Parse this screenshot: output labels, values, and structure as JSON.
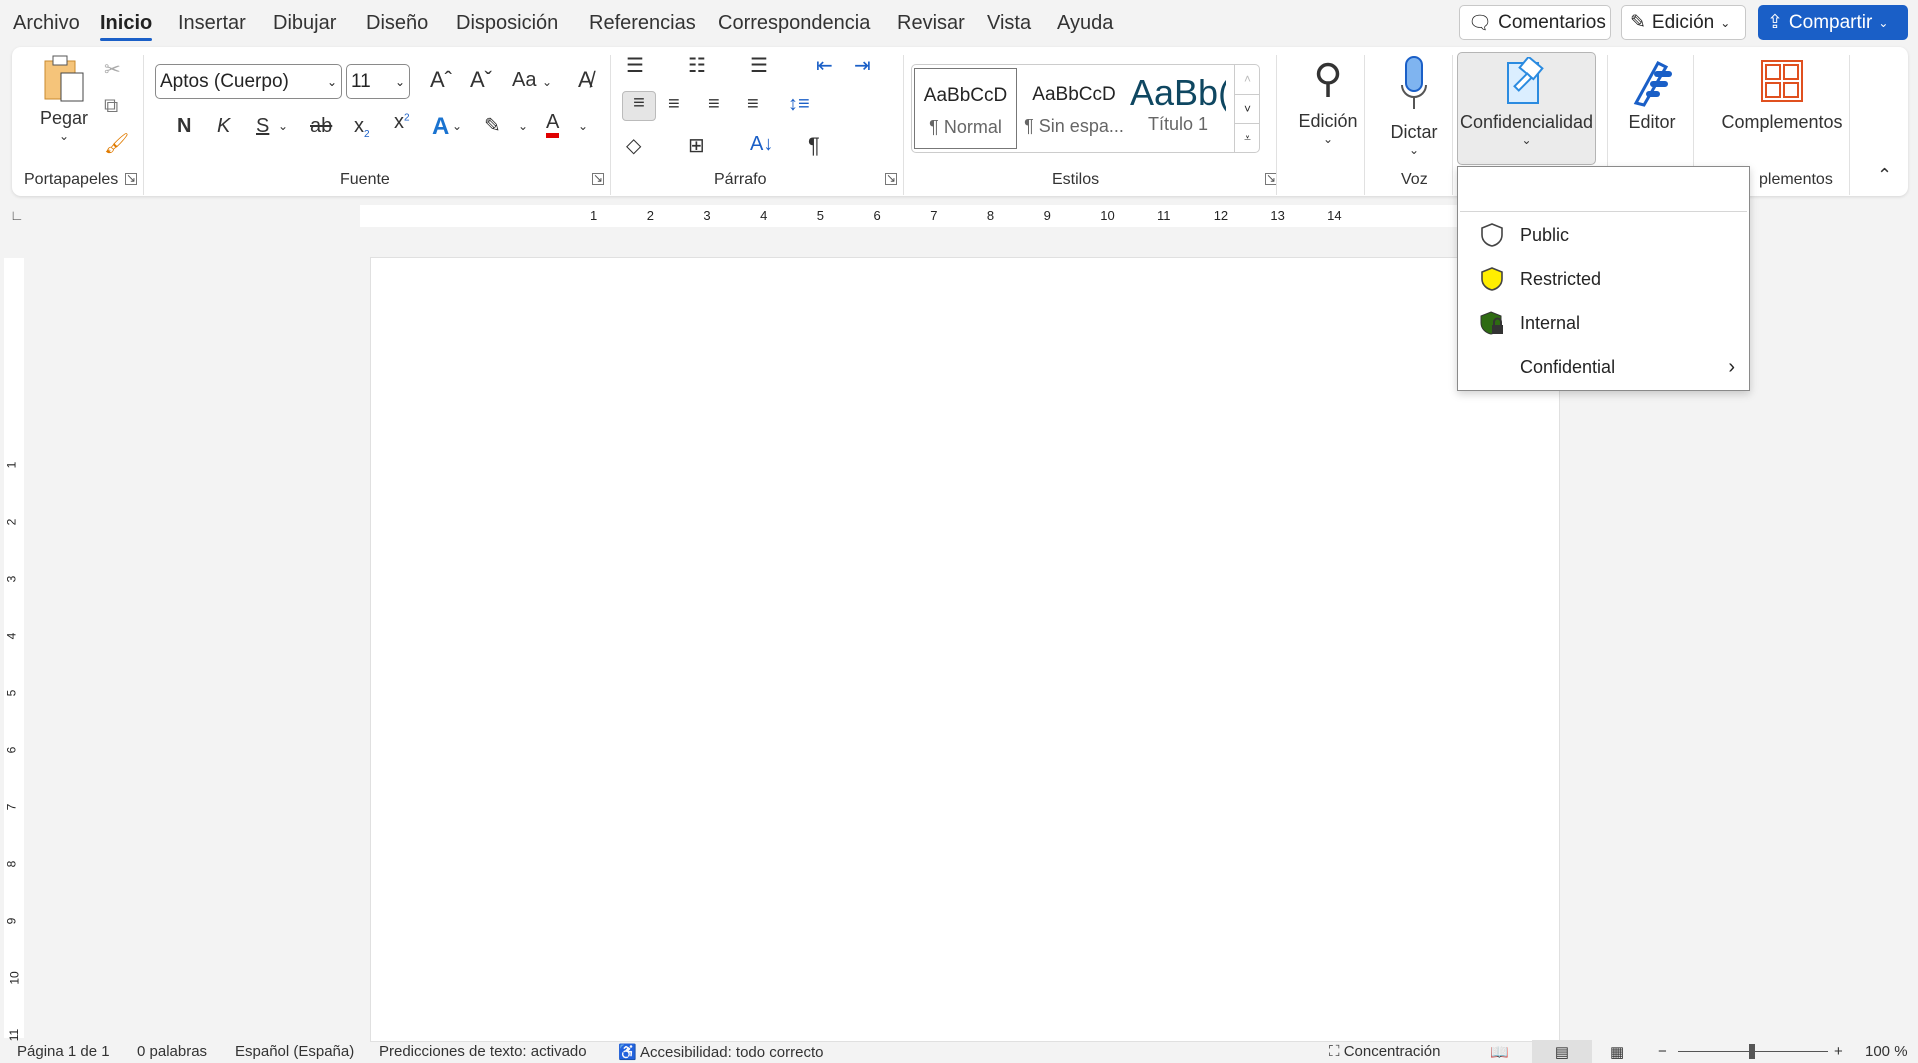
{
  "menu": {
    "tabs": [
      "Archivo",
      "Inicio",
      "Insertar",
      "Dibujar",
      "Diseño",
      "Disposición",
      "Referencias",
      "Correspondencia",
      "Revisar",
      "Vista",
      "Ayuda"
    ],
    "active": "Inicio"
  },
  "top_buttons": {
    "comments": "Comentarios",
    "editing": "Edición",
    "share": "Compartir"
  },
  "ribbon": {
    "clipboard": {
      "paste": "Pegar",
      "label": "Portapapeles"
    },
    "font": {
      "name": "Aptos (Cuerpo)",
      "size": "11",
      "case": "Aa",
      "bold": "N",
      "italic": "K",
      "underline": "S",
      "strike": "ab",
      "label": "Fuente"
    },
    "paragraph": {
      "label": "Párrafo"
    },
    "styles": {
      "items": [
        {
          "preview": "AaBbCcD",
          "name": "¶ Normal"
        },
        {
          "preview": "AaBbCcD",
          "name": "¶ Sin espa..."
        },
        {
          "preview": "AaBb(",
          "name": "Título 1"
        }
      ],
      "label": "Estilos"
    },
    "editing": {
      "label": "Edición"
    },
    "voice": {
      "dictate": "Dictar",
      "label": "Voz"
    },
    "sensitivity": {
      "label": "Confidencialidad"
    },
    "editor": {
      "label": "Editor"
    },
    "addins": {
      "button": "Complementos",
      "label": "plementos"
    }
  },
  "ruler": {
    "numbers": [
      "1",
      "2",
      "3",
      "4",
      "5",
      "6",
      "7",
      "8",
      "9",
      "10",
      "11",
      "12",
      "13",
      "14"
    ],
    "vnumbers": [
      "1",
      "2",
      "3",
      "4",
      "5",
      "6",
      "7",
      "8",
      "9",
      "10",
      "11"
    ]
  },
  "sensitivity_menu": {
    "items": [
      {
        "label": "Public",
        "icon": "shield-outline-icon",
        "color": "#ffffff"
      },
      {
        "label": "Restricted",
        "icon": "shield-yellow-icon",
        "color": "#ffee00"
      },
      {
        "label": "Internal",
        "icon": "shield-green-lock-icon",
        "color": "#2e6b12"
      },
      {
        "label": "Confidential",
        "icon": "",
        "submenu": true
      }
    ]
  },
  "status": {
    "page": "Página 1 de 1",
    "words": "0 palabras",
    "language": "Español (España)",
    "predictions": "Predicciones de texto: activado",
    "accessibility": "Accesibilidad: todo correcto",
    "focus": "Concentración",
    "zoom": "100 %"
  },
  "colors": {
    "accent": "#1a5fc7",
    "font_color": "#e00000"
  }
}
